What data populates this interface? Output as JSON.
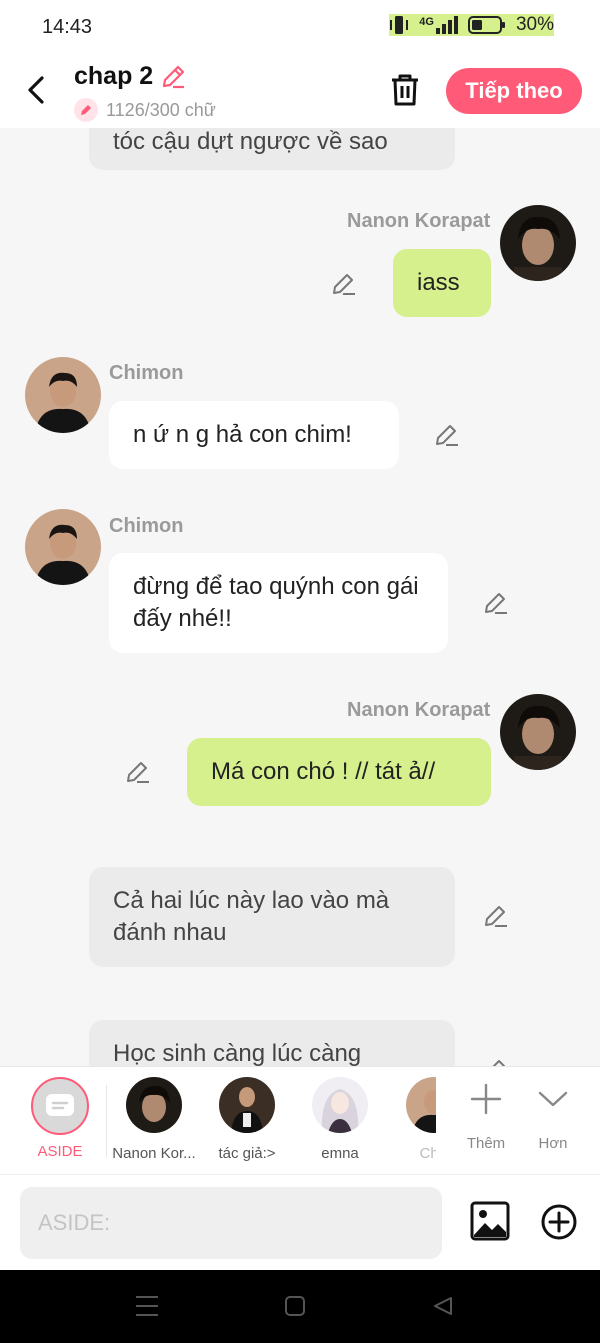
{
  "status": {
    "time": "14:43",
    "network": "4G",
    "battery": "30%"
  },
  "header": {
    "title": "chap 2",
    "word_count": "1126/300 chữ",
    "next_label": "Tiếp theo"
  },
  "messages": [
    {
      "type": "narration",
      "text": "tóc cậu dựt ngược về sao"
    },
    {
      "type": "right",
      "name": "Nanon Korapat",
      "text": "iass"
    },
    {
      "type": "left",
      "name": "Chimon",
      "text": "n ứ n g hả con chim!"
    },
    {
      "type": "left",
      "name": "Chimon",
      "text": "đừng để tao quýnh con gái đấy nhé!!"
    },
    {
      "type": "right",
      "name": "Nanon Korapat",
      "text": "Má con chó ! // tát ả//"
    },
    {
      "type": "narration",
      "text": "Cả hai lúc này lao vào mà đánh nhau"
    },
    {
      "type": "narration",
      "text": "Học sinh càng lúc càng"
    }
  ],
  "characters": [
    {
      "label": "ASIDE",
      "color": "#ff5a78"
    },
    {
      "label": "Nanon Kor...",
      "color": "#2a2018"
    },
    {
      "label": "tác giả:>",
      "color": "#3b2e24"
    },
    {
      "label": "emna",
      "color": "#d8d3dd"
    },
    {
      "label": "Chi",
      "color": "#c8a78a"
    }
  ],
  "actions": {
    "add_label": "Thêm",
    "more_label": "Hơn"
  },
  "input": {
    "placeholder": "ASIDE:"
  },
  "colors": {
    "accent": "#ff5a78",
    "bubble_right": "#d6f08d"
  }
}
